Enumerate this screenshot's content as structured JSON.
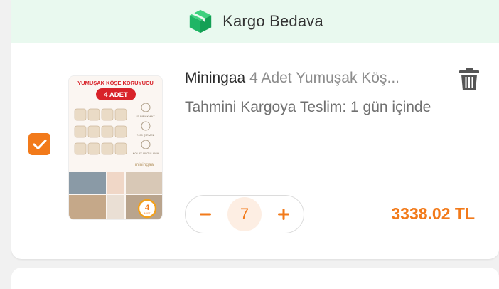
{
  "banner": {
    "icon": "box-icon",
    "text": "Kargo Bedava",
    "accent": "#19b36a"
  },
  "item": {
    "selected": true,
    "brand": "Miningaa",
    "name": "4 Adet Yumuşak Köş...",
    "delivery": "Tahmini Kargoya Teslim: 1 gün içinde",
    "quantity": "7",
    "price": "3338.02 TL",
    "thumbnail": {
      "header": "YUMUŞAK KÖŞE KORUYUCU",
      "badge": "4 ADET",
      "features": [
        "IZ BIRAKMAZ",
        "%99 ÇIRMEZ",
        "KOLAY UYGULAMA"
      ],
      "brand_mark": "miningaa",
      "corner_badge_number": "4",
      "corner_badge_text": "ADET"
    }
  },
  "colors": {
    "accent": "#f27a1a",
    "banner_bg": "#e9f9ef",
    "text_primary": "#2b2b2b",
    "text_secondary": "#707070"
  }
}
